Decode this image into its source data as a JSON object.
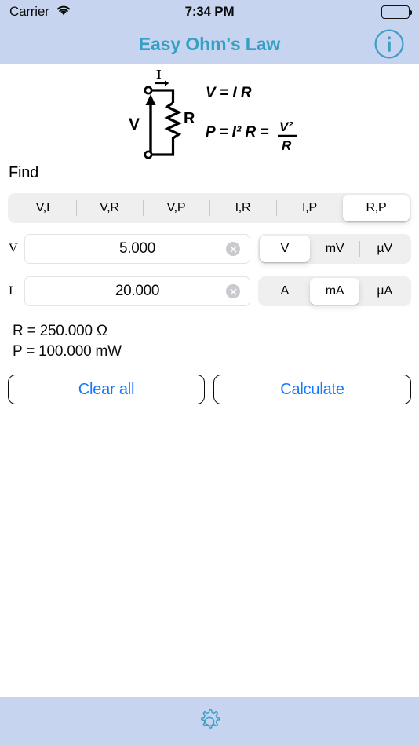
{
  "status_bar": {
    "carrier": "Carrier",
    "wifi_icon": "wifi-icon",
    "time": "7:34 PM",
    "battery_icon": "battery-full-icon"
  },
  "nav_bar": {
    "title": "Easy Ohm's Law",
    "info_icon": "info-circle-icon",
    "background": "#c6d4f0",
    "title_color": "#35a0c4"
  },
  "diagram": {
    "alt": "circuit-diagram",
    "current_label": "I",
    "voltage_label": "V",
    "resistor_label": "R",
    "formula_1": "V = I R",
    "formula_2": "P = I²  R =",
    "formula_2_num": "V²",
    "formula_2_den": "R"
  },
  "find": {
    "label": "Find",
    "options": [
      {
        "label": "V,I",
        "selected": false
      },
      {
        "label": "V,R",
        "selected": false
      },
      {
        "label": "V,P",
        "selected": false
      },
      {
        "label": "I,R",
        "selected": false
      },
      {
        "label": "I,P",
        "selected": false
      },
      {
        "label": "R,P",
        "selected": true
      }
    ]
  },
  "inputs": [
    {
      "label": "V",
      "value": "5.000",
      "placeholder": "",
      "clear_icon": "clear-circle-icon",
      "units": [
        {
          "label": "V",
          "selected": true
        },
        {
          "label": "mV",
          "selected": false
        },
        {
          "label": "µV",
          "selected": false
        }
      ]
    },
    {
      "label": "I",
      "value": "20.000",
      "placeholder": "",
      "clear_icon": "clear-circle-icon",
      "units": [
        {
          "label": "A",
          "selected": false
        },
        {
          "label": "mA",
          "selected": true
        },
        {
          "label": "µA",
          "selected": false
        }
      ]
    }
  ],
  "results": {
    "line_1": "R = 250.000 Ω",
    "line_2": "P = 100.000 mW"
  },
  "actions": {
    "clear_all": "Clear all",
    "calculate": "Calculate",
    "accent_color": "#1578ff"
  },
  "toolbar": {
    "gear_icon": "gear-icon",
    "background": "#c6d4f0",
    "icon_color": "#3f9ec6"
  }
}
